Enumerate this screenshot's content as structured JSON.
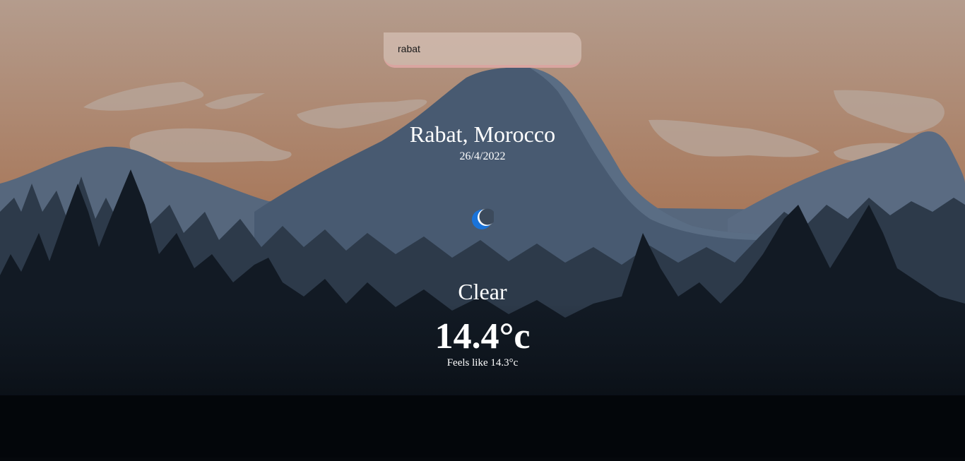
{
  "search": {
    "value": "rabat",
    "icon": "search-bar"
  },
  "weather": {
    "location": "Rabat, Morocco",
    "date": "26/4/2022",
    "icon": "crescent-moon-icon",
    "condition": "Clear",
    "temperature": "14.4°c",
    "feels_like": "Feels like 14.3°c"
  },
  "colors": {
    "sky_top": "#b39a8a",
    "sky_bottom": "#a8785c",
    "mountain": "#4a5a70",
    "forest_dark": "#0a0f15",
    "search_border": "#d9a5a0",
    "moon": "#1a73d9"
  }
}
